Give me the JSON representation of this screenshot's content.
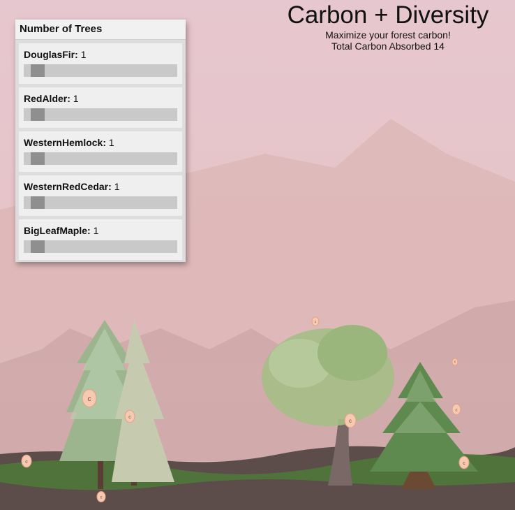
{
  "header": {
    "title": "Carbon + Diversity",
    "subtitle": "Maximize your forest carbon!",
    "carbon_text": "Total Carbon Absorbed 14"
  },
  "panel": {
    "title": "Number of Trees",
    "sliders": [
      {
        "name": "DouglasFir",
        "value": "1",
        "fraction": 0.05
      },
      {
        "name": "RedAlder",
        "value": "1",
        "fraction": 0.05
      },
      {
        "name": "WesternHemlock",
        "value": "1",
        "fraction": 0.05
      },
      {
        "name": "WesternRedCedar",
        "value": "1",
        "fraction": 0.05
      },
      {
        "name": "BigLeafMaple",
        "value": "1",
        "fraction": 0.05
      }
    ]
  },
  "scene": {
    "carbon_token_label": "c",
    "colors": {
      "sky": "#e8c9d0",
      "mountain": "#d7b0b3",
      "ground": "#5d4d4a",
      "grass": "#4e7a3a",
      "token": "#f6c9b1"
    }
  }
}
